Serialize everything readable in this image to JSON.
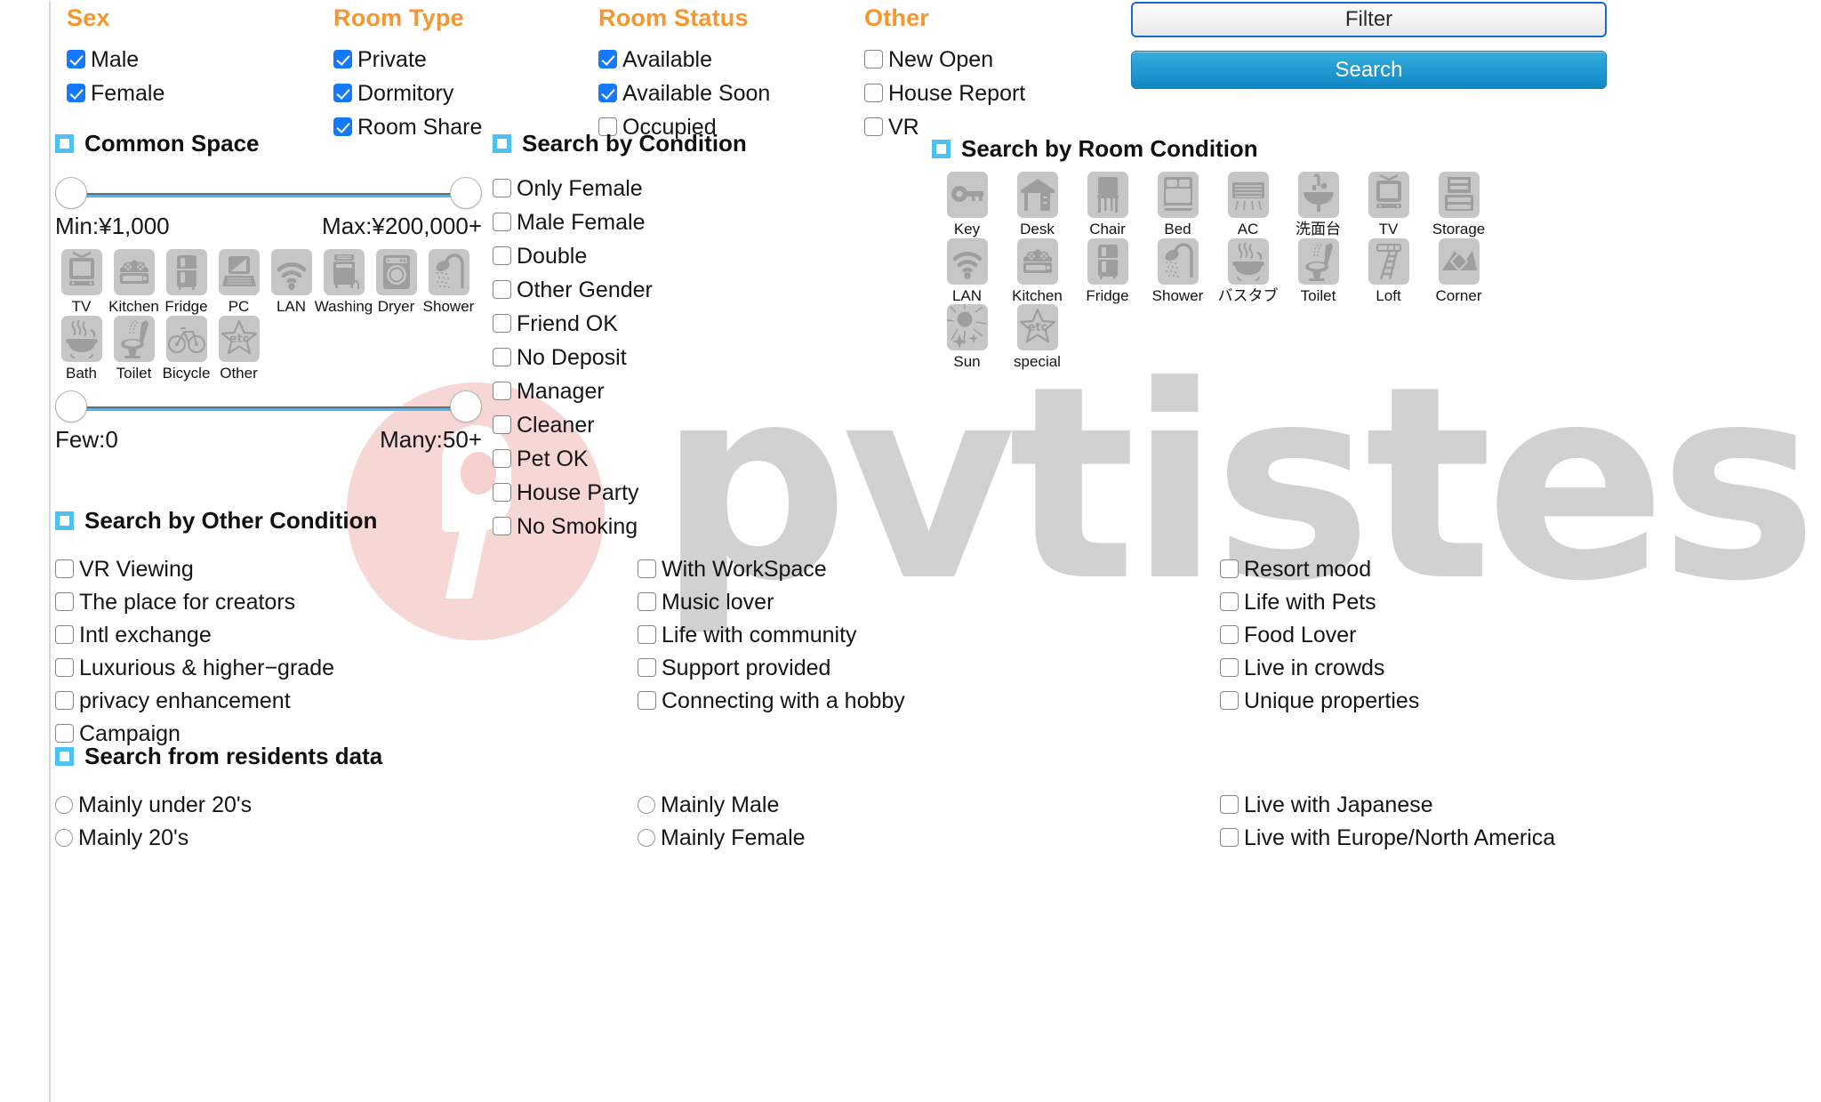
{
  "watermark": {
    "text": "pvtistes"
  },
  "filters": {
    "groups": [
      {
        "title": "Sex",
        "items": [
          {
            "label": "Male",
            "checked": true
          },
          {
            "label": "Female",
            "checked": true
          }
        ]
      },
      {
        "title": "Room Type",
        "items": [
          {
            "label": "Private",
            "checked": true
          },
          {
            "label": "Dormitory",
            "checked": true
          },
          {
            "label": "Room Share",
            "checked": true
          }
        ]
      },
      {
        "title": "Room Status",
        "items": [
          {
            "label": "Available",
            "checked": true
          },
          {
            "label": "Available Soon",
            "checked": true
          },
          {
            "label": "Occupied",
            "checked": false
          }
        ]
      },
      {
        "title": "Other",
        "items": [
          {
            "label": "New Open",
            "checked": false
          },
          {
            "label": "House Report",
            "checked": false
          },
          {
            "label": "VR",
            "checked": false
          }
        ]
      }
    ],
    "filter_button": "Filter",
    "search_button": "Search"
  },
  "common_space": {
    "title": "Common Space",
    "price_slider": {
      "min_label": "Min:¥1,000",
      "max_label": "Max:¥200,000+",
      "min_pos": 0,
      "max_pos": 100
    },
    "count_slider": {
      "min_label": "Few:0",
      "max_label": "Many:50+",
      "min_pos": 0,
      "max_pos": 100
    },
    "icons": [
      {
        "name": "TV",
        "icon": "tv-icon"
      },
      {
        "name": "Kitchen",
        "icon": "kitchen-icon"
      },
      {
        "name": "Fridge",
        "icon": "fridge-icon"
      },
      {
        "name": "PC",
        "icon": "pc-icon"
      },
      {
        "name": "LAN",
        "icon": "wifi-icon"
      },
      {
        "name": "Washing",
        "icon": "washer-icon"
      },
      {
        "name": "Dryer",
        "icon": "dryer-icon"
      },
      {
        "name": "Shower",
        "icon": "shower-icon"
      },
      {
        "name": "Bath",
        "icon": "bath-icon"
      },
      {
        "name": "Toilet",
        "icon": "toilet-icon"
      },
      {
        "name": "Bicycle",
        "icon": "bicycle-icon"
      },
      {
        "name": "Other",
        "icon": "etc-icon"
      }
    ]
  },
  "search_by_condition": {
    "title": "Search by Condition",
    "items": [
      {
        "label": "Only Female",
        "checked": false
      },
      {
        "label": "Male Female",
        "checked": false
      },
      {
        "label": "Double",
        "checked": false
      },
      {
        "label": "Other Gender",
        "checked": false
      },
      {
        "label": "Friend OK",
        "checked": false
      },
      {
        "label": "No Deposit",
        "checked": false
      },
      {
        "label": "Manager",
        "checked": false
      },
      {
        "label": "Cleaner",
        "checked": false
      },
      {
        "label": "Pet OK",
        "checked": false
      },
      {
        "label": "House Party",
        "checked": false
      },
      {
        "label": "No Smoking",
        "checked": false
      }
    ]
  },
  "search_by_room_condition": {
    "title": "Search by Room Condition",
    "icons": [
      {
        "name": "Key",
        "icon": "key-icon"
      },
      {
        "name": "Desk",
        "icon": "desk-icon"
      },
      {
        "name": "Chair",
        "icon": "chair-icon"
      },
      {
        "name": "Bed",
        "icon": "bed-icon"
      },
      {
        "name": "AC",
        "icon": "aircon-icon"
      },
      {
        "name": "洗面台",
        "icon": "washbasin-icon"
      },
      {
        "name": "TV",
        "icon": "tv-icon"
      },
      {
        "name": "Storage",
        "icon": "storage-icon"
      },
      {
        "name": "LAN",
        "icon": "wifi-icon"
      },
      {
        "name": "Kitchen",
        "icon": "kitchen-icon"
      },
      {
        "name": "Fridge",
        "icon": "fridge-icon"
      },
      {
        "name": "Shower",
        "icon": "shower-icon"
      },
      {
        "name": "バスタブ",
        "icon": "bath-icon"
      },
      {
        "name": "Toilet",
        "icon": "toilet-icon"
      },
      {
        "name": "Loft",
        "icon": "loft-icon"
      },
      {
        "name": "Corner",
        "icon": "corner-icon"
      },
      {
        "name": "Sun",
        "icon": "sun-icon"
      },
      {
        "name": "special",
        "icon": "etc-icon"
      }
    ]
  },
  "search_by_other_condition": {
    "title": "Search by Other Condition",
    "columns": [
      [
        {
          "label": "VR Viewing",
          "checked": false
        },
        {
          "label": "The place for creators",
          "checked": false
        },
        {
          "label": "Intl exchange",
          "checked": false
        },
        {
          "label": "Luxurious & higher−grade",
          "checked": false
        },
        {
          "label": "privacy enhancement",
          "checked": false
        },
        {
          "label": "Campaign",
          "checked": false
        }
      ],
      [
        {
          "label": "With WorkSpace",
          "checked": false
        },
        {
          "label": "Music lover",
          "checked": false
        },
        {
          "label": "Life with community",
          "checked": false
        },
        {
          "label": "Support provided",
          "checked": false
        },
        {
          "label": "Connecting with a hobby",
          "checked": false
        }
      ],
      [
        {
          "label": "Resort mood",
          "checked": false
        },
        {
          "label": "Life with Pets",
          "checked": false
        },
        {
          "label": "Food Lover",
          "checked": false
        },
        {
          "label": "Live in crowds",
          "checked": false
        },
        {
          "label": "Unique properties",
          "checked": false
        }
      ]
    ]
  },
  "search_from_residents_data": {
    "title": "Search from residents data",
    "columns": [
      {
        "type": "radio",
        "items": [
          {
            "label": "Mainly under 20's",
            "checked": false
          },
          {
            "label": "Mainly 20's",
            "checked": false
          }
        ]
      },
      {
        "type": "radio",
        "items": [
          {
            "label": "Mainly Male",
            "checked": false
          },
          {
            "label": "Mainly Female",
            "checked": false
          }
        ]
      },
      {
        "type": "checkbox",
        "items": [
          {
            "label": "Live with Japanese",
            "checked": false
          },
          {
            "label": "Live with Europe/North America",
            "checked": false
          }
        ]
      }
    ]
  },
  "colors": {
    "accent_orange": "#f5962f",
    "checkbox_blue": "#1579ff",
    "section_square": "#4cc2f1",
    "search_button": "#0f87c4",
    "tile_gray": "#c6c6c6",
    "watermark_gray": "#c9c9c9",
    "watermark_pink": "#f6cfcf"
  }
}
